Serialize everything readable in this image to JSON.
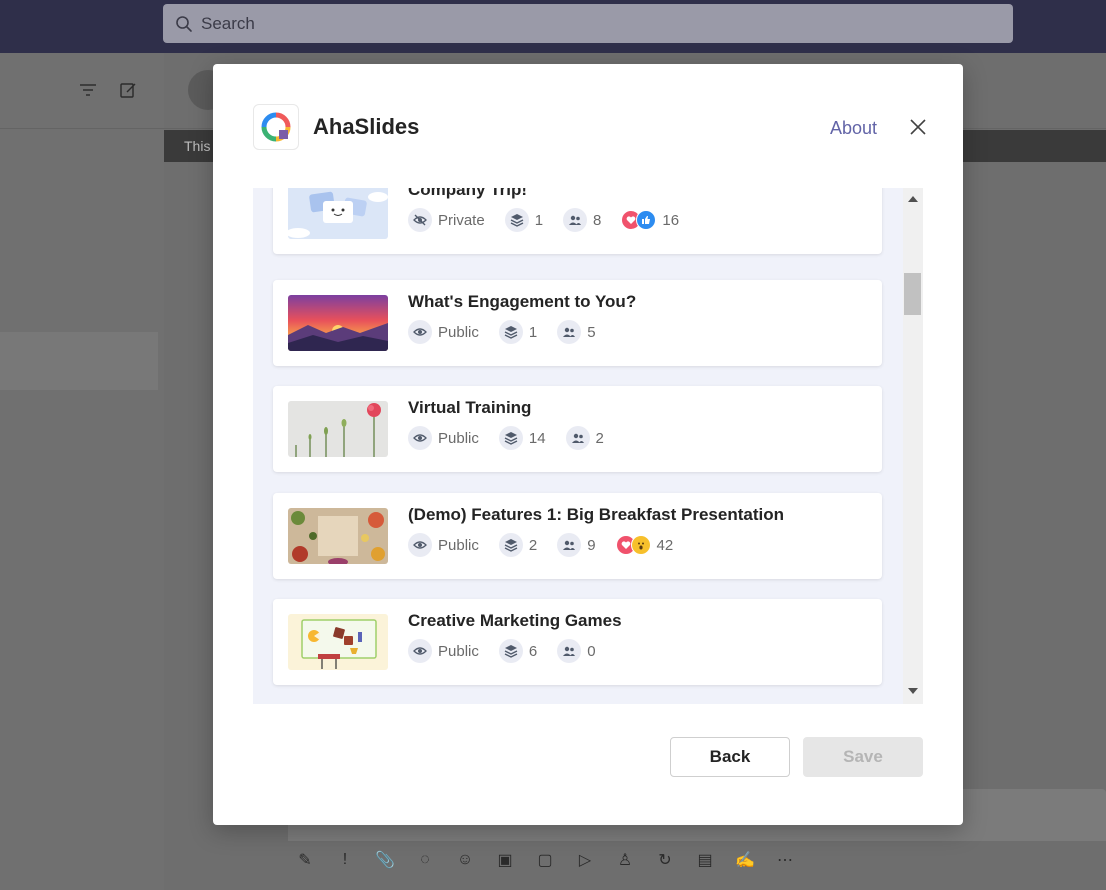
{
  "search": {
    "placeholder": "Search"
  },
  "background": {
    "banner_text": "This"
  },
  "dialog": {
    "app_name": "AhaSlides",
    "about_label": "About",
    "back_label": "Back",
    "save_label": "Save"
  },
  "presentations": [
    {
      "title": "Company Trip!",
      "visibility": "Private",
      "slides": "1",
      "participants": "8",
      "reactions": [
        "heart",
        "like"
      ],
      "reaction_count": "16"
    },
    {
      "title": "What's Engagement to You?",
      "visibility": "Public",
      "slides": "1",
      "participants": "5"
    },
    {
      "title": "Virtual Training",
      "visibility": "Public",
      "slides": "14",
      "participants": "2"
    },
    {
      "title": "(Demo) Features 1: Big Breakfast Presentation",
      "visibility": "Public",
      "slides": "2",
      "participants": "9",
      "reactions": [
        "heart",
        "wow"
      ],
      "reaction_count": "42"
    },
    {
      "title": "Creative Marketing Games",
      "visibility": "Public",
      "slides": "6",
      "participants": "0"
    }
  ],
  "icons": {
    "search": "search-icon",
    "filter": "filter-icon",
    "compose": "compose-icon",
    "close": "close-icon",
    "visibility_private": "eye-off-icon",
    "visibility_public": "eye-icon",
    "slides": "layers-icon",
    "participants": "people-icon"
  },
  "colors": {
    "accent": "#6264a7",
    "topbar": "#2f2f4a",
    "heart": "#f0526c",
    "like": "#2d8cf0",
    "wow": "#f7c02c",
    "list_bg": "#f0f2fa"
  }
}
